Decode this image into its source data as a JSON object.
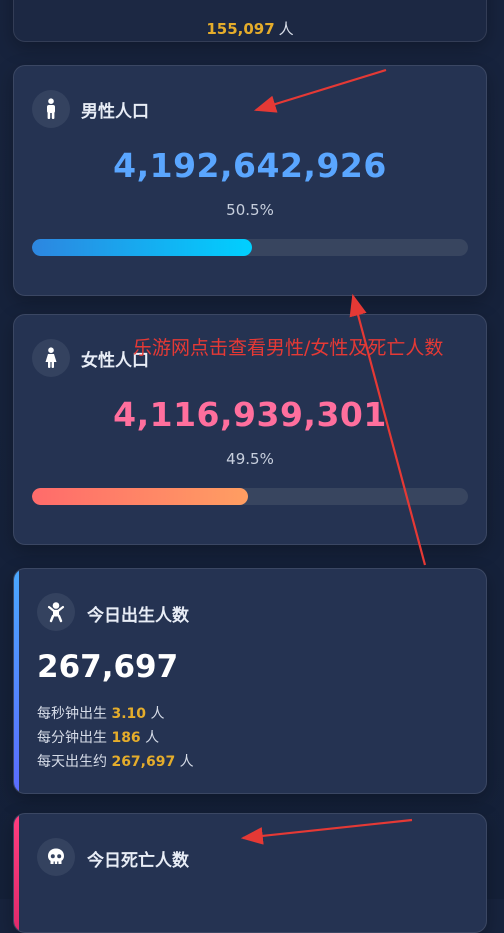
{
  "top_card": {
    "value": "155,097",
    "unit": "人"
  },
  "male": {
    "title": "男性人口",
    "icon": "male-person-icon",
    "count": "4,192,642,926",
    "percent_label": "50.5%",
    "percent": 50.5
  },
  "female": {
    "title": "女性人口",
    "icon": "female-person-icon",
    "count": "4,116,939,301",
    "percent_label": "49.5%",
    "percent": 49.5
  },
  "births": {
    "title": "今日出生人数",
    "icon": "baby-icon",
    "count": "267,697",
    "per_second": {
      "prefix": "每秒钟出生",
      "value": "3.10",
      "unit": "人"
    },
    "per_minute": {
      "prefix": "每分钟出生",
      "value": "186",
      "unit": "人"
    },
    "per_day": {
      "prefix": "每天出生约",
      "value": "267,697",
      "unit": "人"
    }
  },
  "deaths": {
    "title": "今日死亡人数",
    "icon": "skull-icon"
  },
  "annotation": {
    "text": "乐游网点击查看男性/女性及死亡人数",
    "color": "#e53935"
  },
  "colors": {
    "male_accent": "#5aa6ff",
    "female_accent": "#ff6f9d",
    "highlight": "#e5ad2b",
    "card_bg": "#253352"
  }
}
